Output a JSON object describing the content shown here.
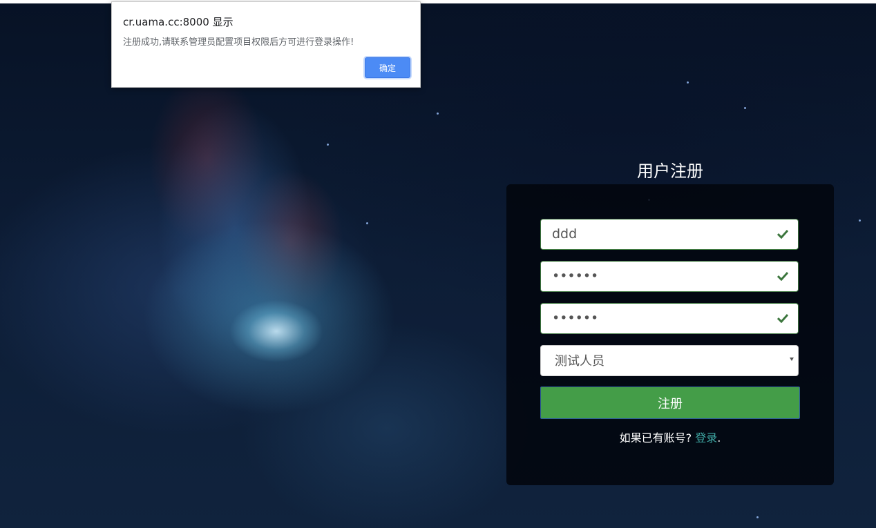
{
  "dialog": {
    "title": "cr.uama.cc:8000 显示",
    "message": "注册成功,请联系管理员配置项目权限后方可进行登录操作!",
    "ok_label": "确定"
  },
  "register": {
    "title": "用户注册",
    "username_value": "ddd",
    "password_value": "••••••",
    "confirm_password_value": "••••••",
    "role_selected": "测试人员",
    "submit_label": "注册",
    "login_prompt": "如果已有账号?",
    "login_link": "登录",
    "login_suffix": "."
  },
  "colors": {
    "success": "#3c763d",
    "submit_bg": "#449d48",
    "link": "#3fa9a5",
    "dialog_button": "#4c8bf5"
  },
  "icons": [
    "check-icon",
    "chevron-down-icon"
  ]
}
